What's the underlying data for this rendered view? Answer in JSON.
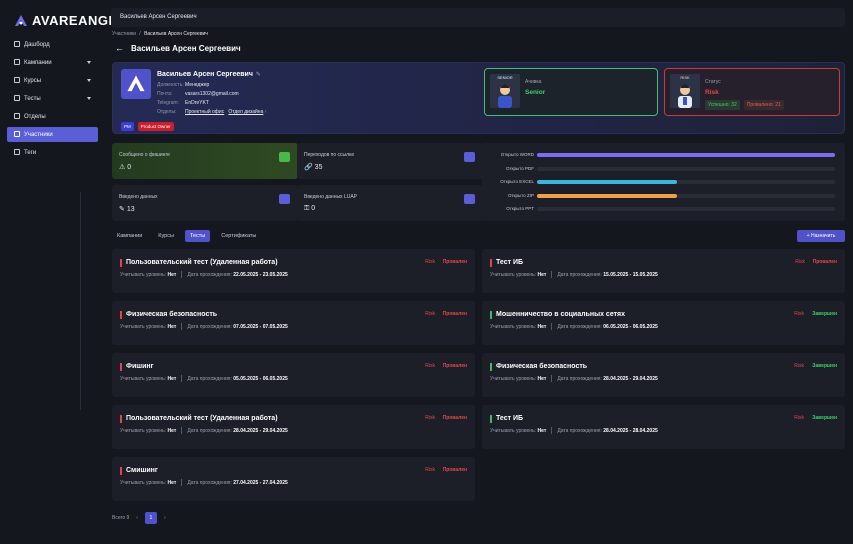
{
  "app": {
    "brand": "AVAREANGE"
  },
  "sidebar": {
    "items": [
      {
        "label": "Дашборд"
      },
      {
        "label": "Кампании"
      },
      {
        "label": "Курсы"
      },
      {
        "label": "Тесты"
      },
      {
        "label": "Отделы"
      },
      {
        "label": "Участники"
      },
      {
        "label": "Теги"
      }
    ]
  },
  "topbar": {
    "user_name": "Васильев Арсен Сергеевич"
  },
  "breadcrumb": {
    "parent": "Участники",
    "separator": "/",
    "current": "Васильев Арсен Сергеевич"
  },
  "page": {
    "title": "Васильев Арсен Сергеевич"
  },
  "profile": {
    "name": "Васильев Арсен Сергеевич",
    "position_label": "Должность:",
    "position": "Менеджер",
    "email_label": "Почта:",
    "email": "vasars1302@gmail.com",
    "telegram_label": "Telegram:",
    "telegram": "EnDreYKT",
    "dept_label": "Отделы:",
    "dept1": "Проектный офис",
    "dept2": "Отдел дизайна",
    "tags": [
      "PM",
      "Product Owner"
    ]
  },
  "level_card": {
    "label": "Ачивка",
    "value": "Senior",
    "value_color": "#3fd06a",
    "image_text": "SENIOR"
  },
  "risk_card": {
    "label": "Статус",
    "value": "Risk",
    "value_color": "#e04848",
    "image_text": "RISK",
    "success": "Успешно: 32",
    "failed": "Провалено: 21"
  },
  "stats": [
    {
      "label": "Сообщено о фишинге",
      "value": "0"
    },
    {
      "label": "Переходов по ссылке",
      "value": "35"
    },
    {
      "label": "Введено данных",
      "value": "13"
    },
    {
      "label": "Введено данных LUAP",
      "value": "0"
    }
  ],
  "opens": [
    {
      "label": "Открыто WORD",
      "value": 1.0,
      "color": "#7b6cf0"
    },
    {
      "label": "Открыто PDF",
      "value": 0.0,
      "color": "#7b6cf0"
    },
    {
      "label": "Открыто EXCEL",
      "value": 0.47,
      "color": "#3ab7d9"
    },
    {
      "label": "Открыто ZIP",
      "value": 0.47,
      "color": "#f0a04a"
    },
    {
      "label": "Открыто PPT",
      "value": 0.0,
      "color": "#7b6cf0"
    }
  ],
  "tabs": [
    {
      "label": "Кампании"
    },
    {
      "label": "Курсы"
    },
    {
      "label": "Тесты"
    },
    {
      "label": "Сертификаты"
    }
  ],
  "assign_button": "+ Назначить",
  "tests_left": [
    {
      "title": "Пользовательский тест (Удаленная работа)",
      "level_label": "Учитывать уровень:",
      "level": "Нет",
      "date_label": "Дата прохождения:",
      "date": "22.05.2025 - 23.05.2025",
      "risk": "Risk",
      "status": "Провален",
      "status_kind": "fail"
    },
    {
      "title": "Физическая безопасность",
      "level_label": "Учитывать уровень:",
      "level": "Нет",
      "date_label": "Дата прохождения:",
      "date": "07.05.2025 - 07.05.2025",
      "risk": "Risk",
      "status": "Провален",
      "status_kind": "fail"
    },
    {
      "title": "Фишинг",
      "level_label": "Учитывать уровень:",
      "level": "Нет",
      "date_label": "Дата прохождения:",
      "date": "05.05.2025 - 06.05.2025",
      "risk": "Risk",
      "status": "Провален",
      "status_kind": "fail"
    },
    {
      "title": "Пользовательский тест (Удаленная работа)",
      "level_label": "Учитывать уровень:",
      "level": "Нет",
      "date_label": "Дата прохождения:",
      "date": "28.04.2025 - 29.04.2025",
      "risk": "Risk",
      "status": "Провален",
      "status_kind": "fail"
    },
    {
      "title": "Смишинг",
      "level_label": "Учитывать уровень:",
      "level": "Нет",
      "date_label": "Дата прохождения:",
      "date": "27.04.2025 - 27.04.2025",
      "risk": "Risk",
      "status": "Провален",
      "status_kind": "fail"
    }
  ],
  "tests_right": [
    {
      "title": "Тест ИБ",
      "level_label": "Учитывать уровень:",
      "level": "Нет",
      "date_label": "Дата прохождения:",
      "date": "15.05.2025 - 15.05.2025",
      "risk": "Risk",
      "status": "Провален",
      "status_kind": "fail"
    },
    {
      "title": "Мошенничество в социальных сетях",
      "level_label": "Учитывать уровень:",
      "level": "Нет",
      "date_label": "Дата прохождения:",
      "date": "06.05.2025 - 06.05.2025",
      "risk": "Risk",
      "status": "Завершен",
      "status_kind": "done"
    },
    {
      "title": "Физическая безопасность",
      "level_label": "Учитывать уровень:",
      "level": "Нет",
      "date_label": "Дата прохождения:",
      "date": "28.04.2025 - 29.04.2025",
      "risk": "Risk",
      "status": "Завершен",
      "status_kind": "done"
    },
    {
      "title": "Тест ИБ",
      "level_label": "Учитывать уровень:",
      "level": "Нет",
      "date_label": "Дата прохождения:",
      "date": "28.04.2025 - 28.04.2025",
      "risk": "Risk",
      "status": "Завершен",
      "status_kind": "done"
    }
  ],
  "pagination": {
    "total": "Всего 9",
    "prev": "‹",
    "page": "1",
    "next": "›"
  }
}
